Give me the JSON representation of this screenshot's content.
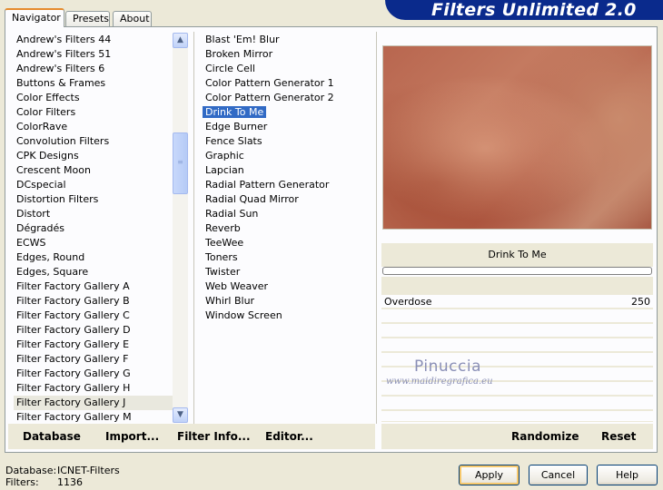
{
  "tabs": [
    "Navigator",
    "Presets",
    "About"
  ],
  "banner_title": "Filters Unlimited 2.0",
  "categories": [
    "Andrew's Filters 44",
    "Andrew's Filters 51",
    "Andrew's Filters 6",
    "Buttons & Frames",
    "Color Effects",
    "Color Filters",
    "ColorRave",
    "Convolution Filters",
    "CPK Designs",
    "Crescent Moon",
    "DCspecial",
    "Distortion Filters",
    "Distort",
    "Dégradés",
    "ECWS",
    "Edges, Round",
    "Edges, Square",
    "Filter Factory Gallery A",
    "Filter Factory Gallery B",
    "Filter Factory Gallery C",
    "Filter Factory Gallery D",
    "Filter Factory Gallery E",
    "Filter Factory Gallery F",
    "Filter Factory Gallery G",
    "Filter Factory Gallery H",
    "Filter Factory Gallery J",
    "Filter Factory Gallery M"
  ],
  "selected_category": "Filter Factory Gallery J",
  "filters": [
    "Blast 'Em! Blur",
    "Broken Mirror",
    "Circle Cell",
    "Color Pattern Generator 1",
    "Color Pattern Generator 2",
    "Drink To Me",
    "Edge Burner",
    "Fence Slats",
    "Graphic",
    "Lapcian",
    "Radial Pattern Generator",
    "Radial Quad Mirror",
    "Radial Sun",
    "Reverb",
    "TeeWee",
    "Toners",
    "Twister",
    "Web Weaver",
    "Whirl Blur",
    "Window Screen"
  ],
  "selected_filter": "Drink To Me",
  "preview_filter_name": "Drink To Me",
  "parameter": {
    "label": "Overdose",
    "value": "250"
  },
  "watermark": {
    "name": "Pinuccia",
    "url": "www.maidiregrafica.eu"
  },
  "toolbar": {
    "database": "Database",
    "import": "Import...",
    "filter_info": "Filter Info...",
    "editor": "Editor...",
    "randomize": "Randomize",
    "reset": "Reset"
  },
  "footer": {
    "database_label": "Database:",
    "database_value": "ICNET-Filters",
    "filters_label": "Filters:",
    "filters_value": "1136"
  },
  "buttons": {
    "apply": "Apply",
    "cancel": "Cancel",
    "help": "Help"
  },
  "icons": {
    "scroll_up": "chevron-up-icon",
    "scroll_down": "chevron-down-icon",
    "grip": "scroll-grip-icon"
  }
}
